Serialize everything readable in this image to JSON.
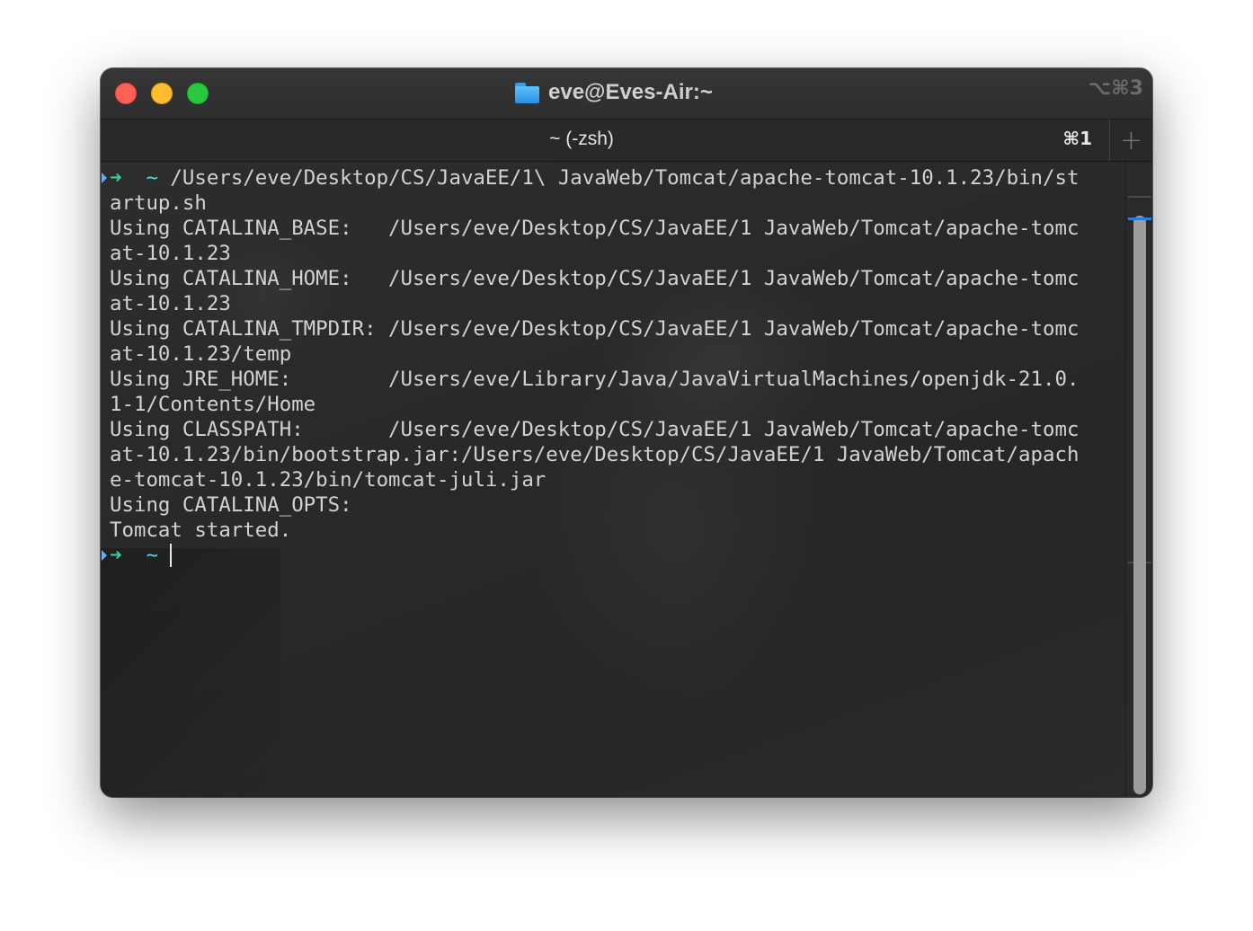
{
  "window": {
    "title": "eve@Eves-Air:~",
    "shortcut": "⌥⌘3",
    "folder_icon": "folder-icon"
  },
  "tabs": [
    {
      "label": "~ (-zsh)",
      "shortcut": "⌘1",
      "active": true
    }
  ],
  "new_tab": {
    "label": "+"
  },
  "colors": {
    "close": "#fe5f57",
    "minimize": "#febc2e",
    "zoom": "#28c840",
    "prompt_arrow": "#36d18a",
    "prompt_tilde": "#4fd8e6",
    "text": "#d2d2d2",
    "scroll_accent": "#2c7be5"
  },
  "terminal": {
    "command_prompt": {
      "arrow": "➜",
      "dir": "~",
      "command": "/Users/eve/Desktop/CS/JavaEE/1\\ JavaWeb/Tomcat/apache-tomcat-10.1.23/bin/st"
    },
    "lines": [
      "artup.sh",
      "Using CATALINA_BASE:   /Users/eve/Desktop/CS/JavaEE/1 JavaWeb/Tomcat/apache-tomc",
      "at-10.1.23",
      "Using CATALINA_HOME:   /Users/eve/Desktop/CS/JavaEE/1 JavaWeb/Tomcat/apache-tomc",
      "at-10.1.23",
      "Using CATALINA_TMPDIR: /Users/eve/Desktop/CS/JavaEE/1 JavaWeb/Tomcat/apache-tomc",
      "at-10.1.23/temp",
      "Using JRE_HOME:        /Users/eve/Library/Java/JavaVirtualMachines/openjdk-21.0.",
      "1-1/Contents/Home",
      "Using CLASSPATH:       /Users/eve/Desktop/CS/JavaEE/1 JavaWeb/Tomcat/apache-tomc",
      "at-10.1.23/bin/bootstrap.jar:/Users/eve/Desktop/CS/JavaEE/1 JavaWeb/Tomcat/apach",
      "e-tomcat-10.1.23/bin/tomcat-juli.jar",
      "Using CATALINA_OPTS:",
      "Tomcat started."
    ],
    "current_prompt": {
      "arrow": "➜",
      "dir": "~"
    }
  }
}
